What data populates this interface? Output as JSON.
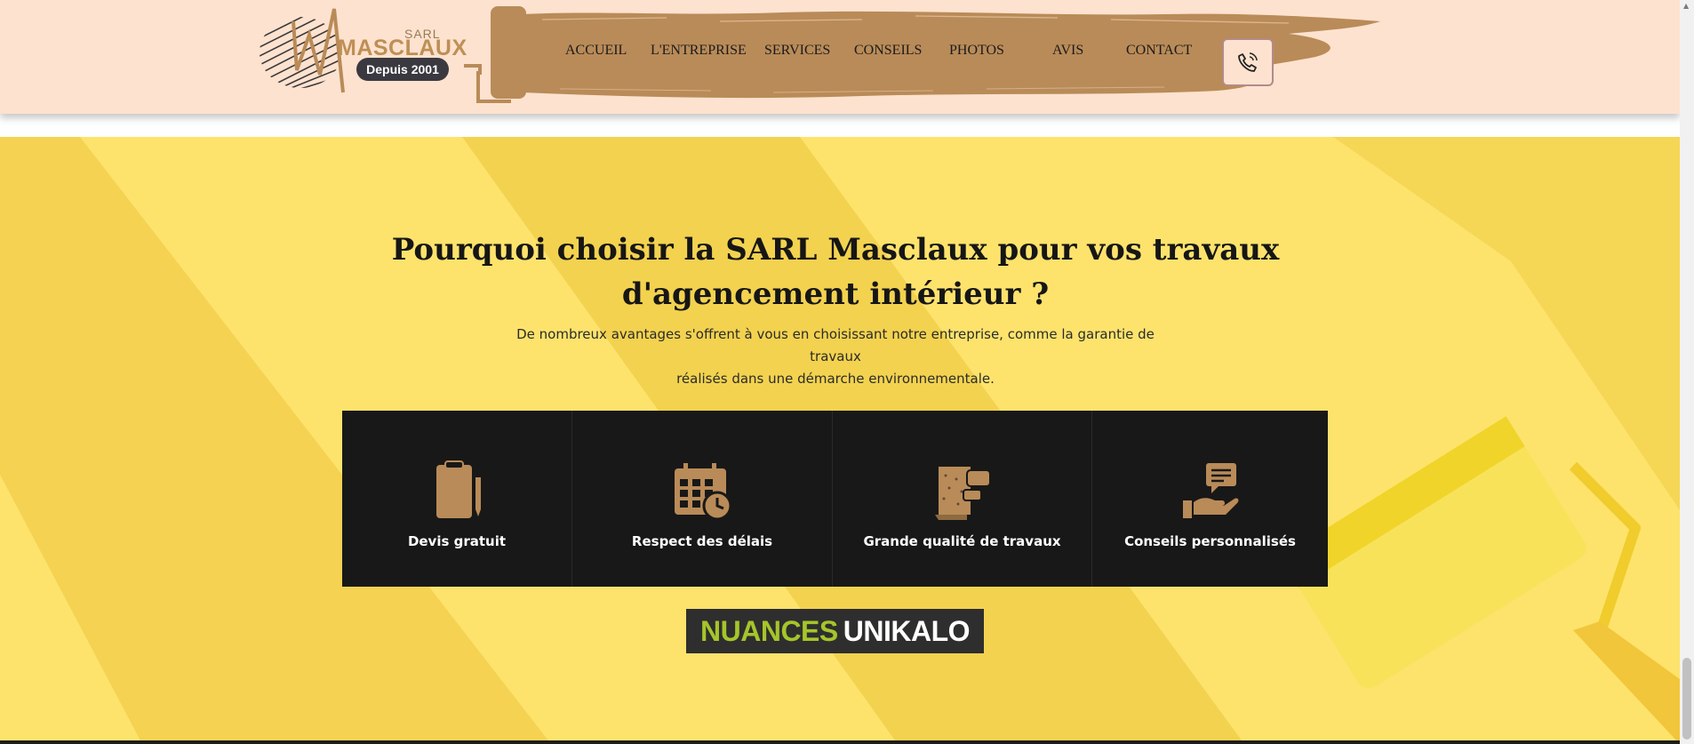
{
  "header": {
    "logo": {
      "sarl": "SARL",
      "name": "MASCLAUX",
      "since": "Depuis 2001"
    },
    "nav": [
      {
        "label": "ACCUEIL"
      },
      {
        "label": "L'ENTREPRISE"
      },
      {
        "label": "SERVICES"
      },
      {
        "label": "CONSEILS"
      },
      {
        "label": "PHOTOS"
      },
      {
        "label": "AVIS"
      },
      {
        "label": "CONTACT"
      }
    ],
    "phone_icon": "phone-icon"
  },
  "main": {
    "title_line1": "Pourquoi choisir la SARL Masclaux pour vos travaux",
    "title_line2": "d'agencement intérieur ?",
    "subtitle_line1": "De nombreux avantages s'offrent à vous en choisissant notre entreprise, comme la garantie de travaux",
    "subtitle_line2": "réalisés dans une démarche environnementale.",
    "features": [
      {
        "label": "Devis gratuit",
        "icon": "clipboard-icon"
      },
      {
        "label": "Respect des délais",
        "icon": "calendar-clock-icon"
      },
      {
        "label": "Grande qualité de travaux",
        "icon": "wallpaper-roll-icon"
      },
      {
        "label": "Conseils personnalisés",
        "icon": "hand-message-icon"
      }
    ],
    "brand_banner": {
      "part1": "NUANCES",
      "part2": "UNIKALO"
    }
  },
  "colors": {
    "header_bg": "#fde2cf",
    "accent_brown": "#b98b58",
    "main_bg": "#fbe27a",
    "feature_bg": "#181818",
    "nuances_green": "#a5c52a"
  }
}
